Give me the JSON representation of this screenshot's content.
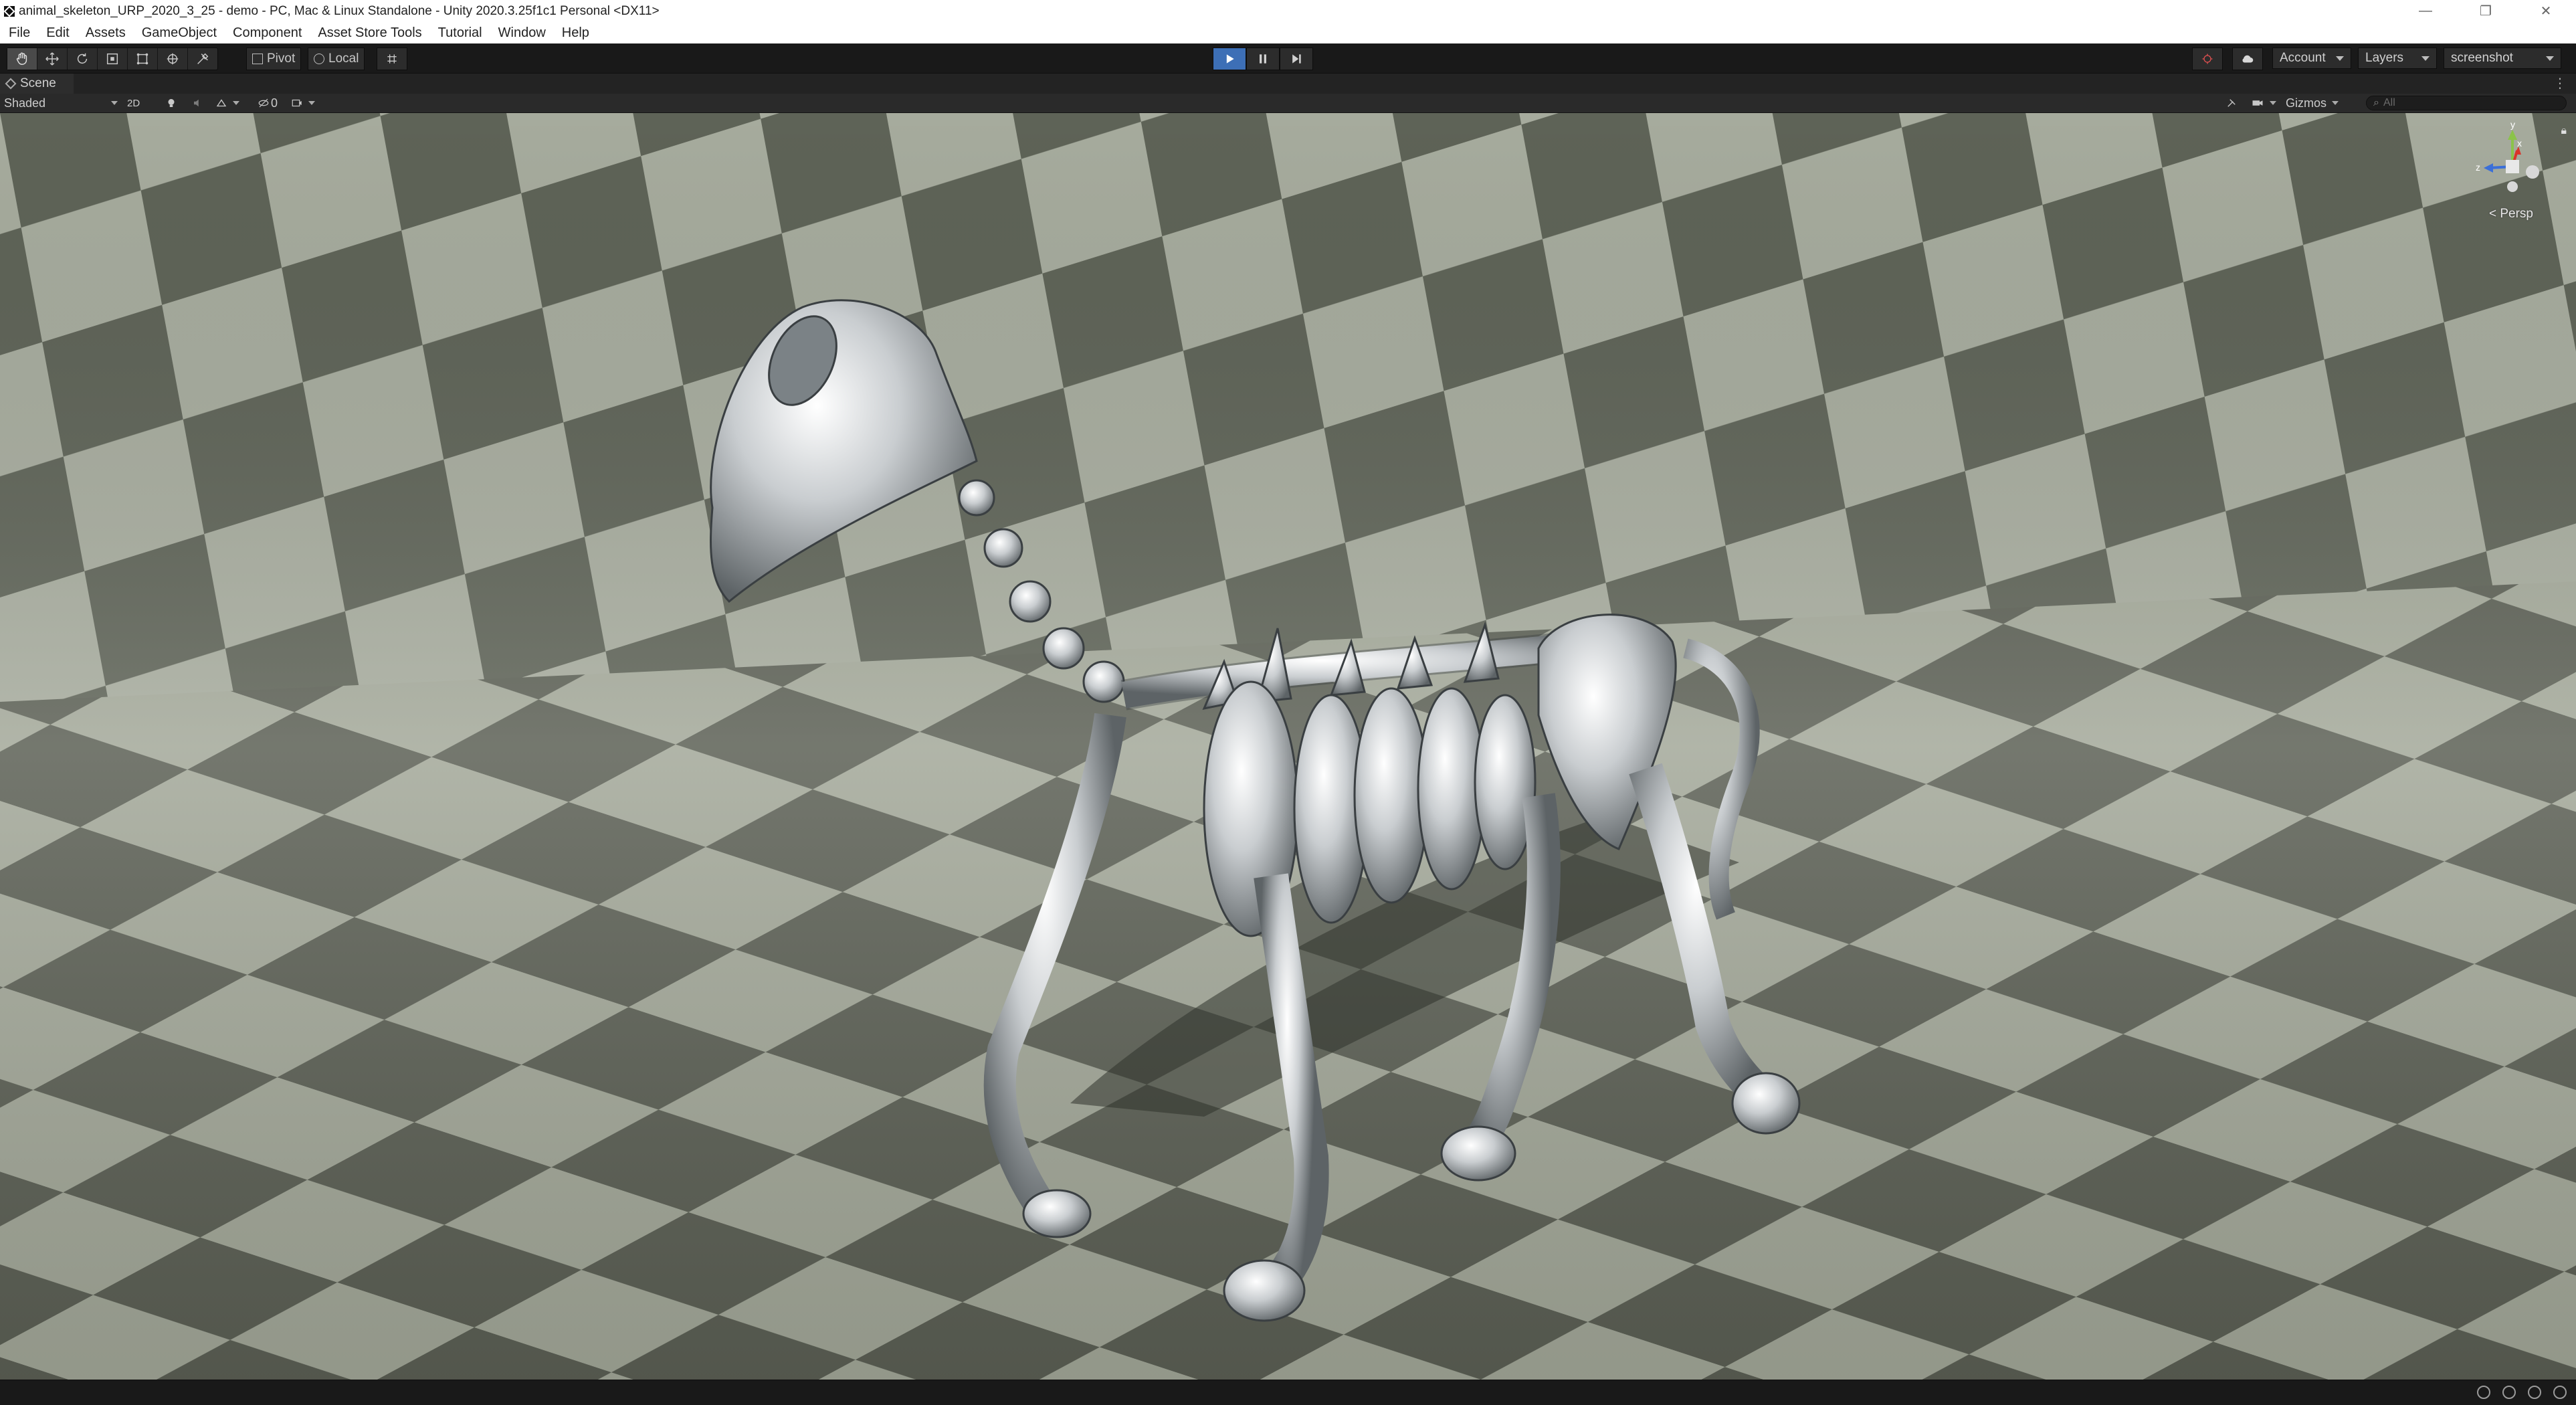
{
  "window": {
    "title": "animal_skeleton_URP_2020_3_25 - demo - PC, Mac & Linux Standalone - Unity 2020.3.25f1c1 Personal <DX11>",
    "controls": {
      "minimize": "—",
      "restore": "❐",
      "close": "✕"
    }
  },
  "menubar": {
    "items": [
      "File",
      "Edit",
      "Assets",
      "GameObject",
      "Component",
      "Asset Store Tools",
      "Tutorial",
      "Window",
      "Help"
    ]
  },
  "toolbar": {
    "transform_tools": [
      "hand-icon",
      "move-icon",
      "rotate-icon",
      "scale-icon",
      "rect-tool-icon",
      "transform-icon",
      "custom-tool-icon"
    ],
    "pivot_label": "Pivot",
    "local_label": "Local",
    "account_label": "Account",
    "layers_label": "Layers",
    "layout_label": "screenshot",
    "play_state": "playing",
    "accent_color": "#3d6fb6"
  },
  "scene_tab": {
    "label": "Scene"
  },
  "scene_toolbar": {
    "draw_mode": "Shaded",
    "mode_2d": "2D",
    "hidden_count": "0",
    "gizmos_label": "Gizmos",
    "search_placeholder": "All"
  },
  "viewport": {
    "projection_label": "Persp",
    "axes": {
      "x": "x",
      "y": "y",
      "z": "z"
    },
    "axis_colors": {
      "x": "#d9352b",
      "y": "#8bc34a",
      "z": "#3b6fd8"
    },
    "floor_colors": {
      "light": "#a5ab9c",
      "dark": "#5d6155"
    }
  }
}
